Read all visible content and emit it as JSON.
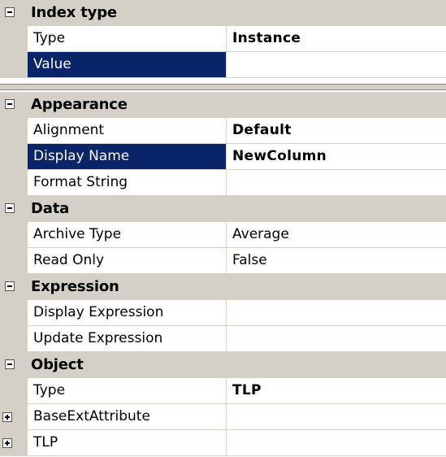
{
  "grid": {
    "top_section": {
      "category": "Index type",
      "rows": [
        {
          "name": "Type",
          "value": "Instance",
          "bold": true
        },
        {
          "name": "Value",
          "value": "",
          "selected": true
        }
      ]
    },
    "categories": [
      {
        "name": "Appearance",
        "rows": [
          {
            "name": "Alignment",
            "value": "Default",
            "bold": true
          },
          {
            "name": "Display Name",
            "value": "NewColumn",
            "bold": true,
            "selected": true
          },
          {
            "name": "Format String",
            "value": ""
          }
        ]
      },
      {
        "name": "Data",
        "rows": [
          {
            "name": "Archive Type",
            "value": "Average"
          },
          {
            "name": "Read Only",
            "value": "False"
          }
        ]
      },
      {
        "name": "Expression",
        "rows": [
          {
            "name": "Display Expression",
            "value": ""
          },
          {
            "name": "Update Expression",
            "value": ""
          }
        ]
      },
      {
        "name": "Object",
        "rows": [
          {
            "name": "Type",
            "value": "TLP",
            "bold": true
          },
          {
            "name": "BaseExtAttribute",
            "value": "",
            "expandable": true
          },
          {
            "name": "TLP",
            "value": "",
            "expandable": true
          }
        ]
      }
    ]
  },
  "icons": {
    "collapse": "minus-box-icon",
    "expand": "plus-box-icon"
  },
  "colors": {
    "selection": "#0a246a",
    "category_bg": "#d4d0c8",
    "grid_line": "#d4d0c8"
  }
}
